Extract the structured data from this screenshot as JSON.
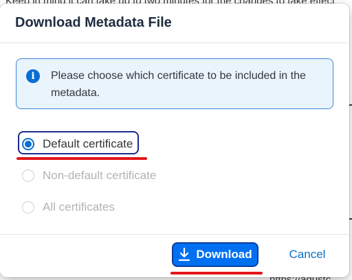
{
  "background": {
    "top_text": "Keep in mind it can take up to two minutes for the changes to take effect",
    "bottom_text": "https://aqustc"
  },
  "dialog": {
    "title": "Download Metadata File",
    "info": {
      "icon": "info-icon",
      "message": "Please choose which certificate to be included in the metadata."
    },
    "options": [
      {
        "label": "Default certificate",
        "selected": true,
        "disabled": false
      },
      {
        "label": "Non-default certificate",
        "selected": false,
        "disabled": true
      },
      {
        "label": "All certificates",
        "selected": false,
        "disabled": true
      }
    ],
    "buttons": {
      "download_label": "Download",
      "download_icon": "download-icon",
      "cancel_label": "Cancel"
    }
  },
  "colors": {
    "accent": "#0070f2",
    "link": "#0a6ed1",
    "annotation_red": "#e3151a"
  }
}
